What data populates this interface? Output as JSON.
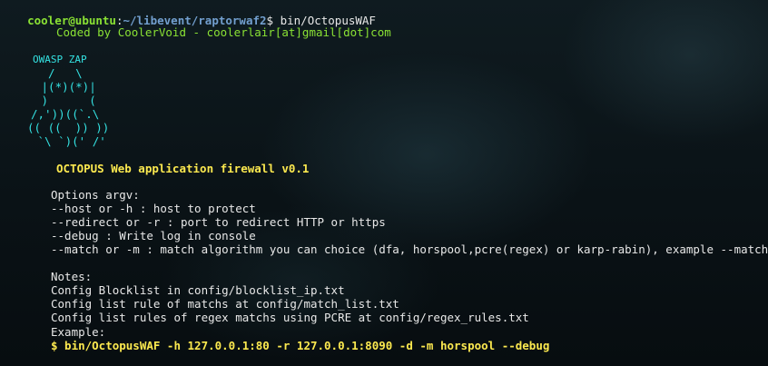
{
  "prompt": {
    "user_host": "cooler@ubuntu",
    "sep": ":",
    "path": "~/libevent/raptorwaf2",
    "symbol": "$",
    "command": " bin/OctopusWAF"
  },
  "credit": "Coded by CoolerVoid - coolerlair[at]gmail[dot]com",
  "ascii_art": {
    "title": "OWASP ZAP",
    "lines": [
      "  /   \\",
      " |(*)(*)|",
      " )      (",
      "/,'))((`.\\",
      "(( ((  )) ))",
      " `\\ `)(' /'"
    ]
  },
  "banner": "OCTOPUS Web application firewall v0.1",
  "options": {
    "heading": "Options argv:",
    "items": [
      "--host or -h : host to protect",
      "--redirect or -r : port to redirect HTTP or https",
      "--debug : Write log in console",
      "--match or -m : match algorithm you can choice (dfa, horspool,pcre(regex) or karp-rabin), example --match pcre"
    ]
  },
  "notes": {
    "heading": "Notes:",
    "items": [
      "Config Blocklist in config/blocklist_ip.txt",
      "Config list rule of matchs at config/match_list.txt",
      "Config list rules of regex matchs using PCRE at config/regex_rules.txt"
    ]
  },
  "example": {
    "heading": "Example:",
    "command": "$ bin/OctopusWAF -h 127.0.0.1:80 -r 127.0.0.1:8090 -d -m horspool --debug"
  }
}
